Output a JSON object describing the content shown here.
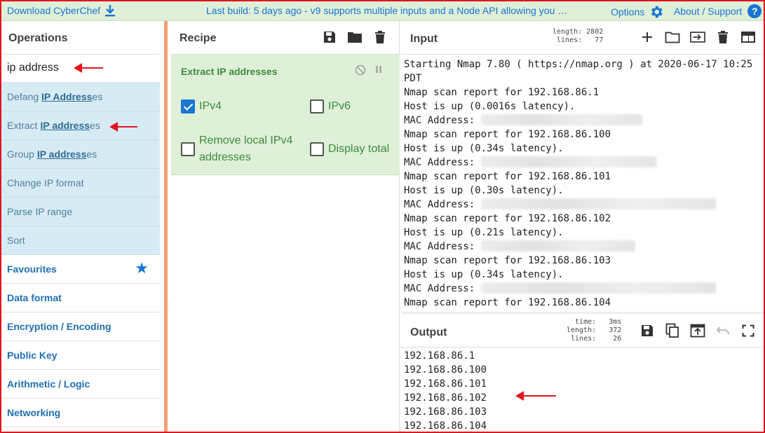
{
  "banner": {
    "download": "Download CyberChef",
    "notice": "Last build: 5 days ago - v9 supports multiple inputs and a Node API allowing you …",
    "options": "Options",
    "about": "About / Support",
    "help_glyph": "?"
  },
  "operations": {
    "title": "Operations",
    "search_value": "ip address",
    "results": [
      {
        "pre": "Defang ",
        "match": "IP Address",
        "post": "es"
      },
      {
        "pre": "Extract ",
        "match": "IP address",
        "post": "es"
      },
      {
        "pre": "Group ",
        "match": "IP address",
        "post": "es"
      },
      {
        "pre": "Change IP format",
        "match": "",
        "post": ""
      },
      {
        "pre": "Parse IP range",
        "match": "",
        "post": ""
      },
      {
        "pre": "Sort",
        "match": "",
        "post": ""
      }
    ],
    "categories": [
      "Favourites",
      "Data format",
      "Encryption / Encoding",
      "Public Key",
      "Arithmetic / Logic",
      "Networking"
    ]
  },
  "recipe": {
    "title": "Recipe",
    "operation": "Extract IP addresses",
    "options": {
      "ipv4": {
        "label": "IPv4",
        "checked": true
      },
      "ipv6": {
        "label": "IPv6",
        "checked": false
      },
      "remove_local_line1": "Remove local IPv4",
      "remove_local_line2": "addresses",
      "display_total": "Display total"
    }
  },
  "input": {
    "title": "Input",
    "stats": "length: 2802\n lines:   77",
    "lines": [
      "Starting Nmap 7.80 ( https://nmap.org ) at 2020-06-17 10:25",
      "PDT",
      "Nmap scan report for 192.168.86.1",
      "Host is up (0.0016s latency).",
      "MAC Address: ",
      "Nmap scan report for 192.168.86.100",
      "Host is up (0.34s latency).",
      "MAC Address: ",
      "Nmap scan report for 192.168.86.101",
      "Host is up (0.30s latency).",
      "MAC Address: ",
      "Nmap scan report for 192.168.86.102",
      "Host is up (0.21s latency).",
      "MAC Address: ",
      "Nmap scan report for 192.168.86.103",
      "Host is up (0.34s latency).",
      "MAC Address: ",
      "Nmap scan report for 192.168.86.104"
    ]
  },
  "output": {
    "title": "Output",
    "stats": "  time:   3ms\nlength:   372\n lines:    26",
    "lines": [
      "192.168.86.1",
      "192.168.86.100",
      "192.168.86.101",
      "192.168.86.102",
      "192.168.86.103",
      "192.168.86.104"
    ]
  },
  "colors": {
    "accent": "#1976d2",
    "recipe_bg": "#dff0d8",
    "results_bg": "#d7ebf5",
    "annotation": "#e2141e"
  }
}
